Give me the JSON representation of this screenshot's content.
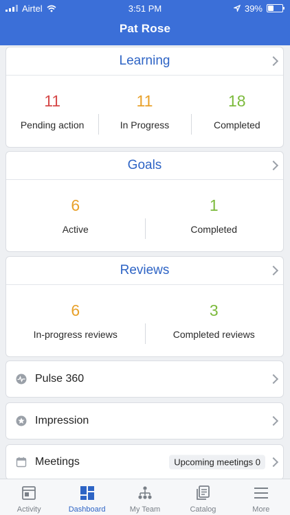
{
  "status_bar": {
    "carrier": "Airtel",
    "time": "3:51 PM",
    "battery": "39%",
    "battery_level": 0.39
  },
  "header": {
    "title": "Pat Rose"
  },
  "learning": {
    "title": "Learning",
    "stats": [
      {
        "value": "11",
        "label": "Pending action",
        "color": "#d64a4a"
      },
      {
        "value": "11",
        "label": "In Progress",
        "color": "#e8a12b"
      },
      {
        "value": "18",
        "label": "Completed",
        "color": "#7cba3c"
      }
    ]
  },
  "goals": {
    "title": "Goals",
    "stats": [
      {
        "value": "6",
        "label": "Active",
        "color": "#e8a12b"
      },
      {
        "value": "1",
        "label": "Completed",
        "color": "#7cba3c"
      }
    ]
  },
  "reviews": {
    "title": "Reviews",
    "stats": [
      {
        "value": "6",
        "label": "In-progress reviews",
        "color": "#e8a12b"
      },
      {
        "value": "3",
        "label": "Completed reviews",
        "color": "#7cba3c"
      }
    ]
  },
  "rows": [
    {
      "label": "Pulse 360",
      "icon": "pulse-icon"
    },
    {
      "label": "Impression",
      "icon": "star-icon"
    },
    {
      "label": "Meetings",
      "icon": "calendar-icon",
      "badge": "Upcoming meetings 0"
    }
  ],
  "tabs": [
    {
      "label": "Activity",
      "icon": "activity-icon"
    },
    {
      "label": "Dashboard",
      "icon": "dashboard-icon",
      "active": true
    },
    {
      "label": "My Team",
      "icon": "team-icon"
    },
    {
      "label": "Catalog",
      "icon": "catalog-icon"
    },
    {
      "label": "More",
      "icon": "menu-icon"
    }
  ],
  "colors": {
    "accent": "#3b6fd8",
    "link": "#2e64c5"
  }
}
